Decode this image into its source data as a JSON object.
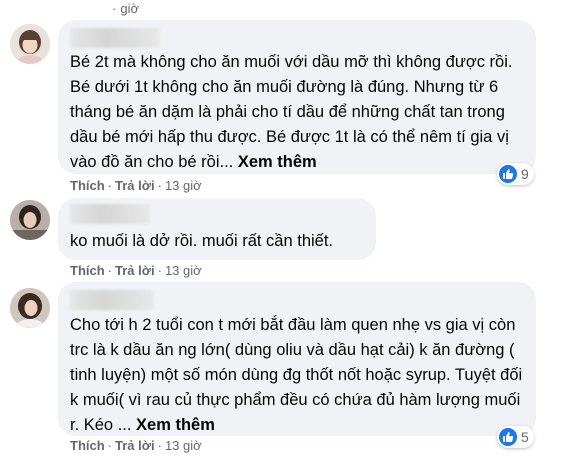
{
  "top": {
    "time": "giờ"
  },
  "comments": [
    {
      "text": "Bé 2t mà không cho ăn muối với dầu mỡ thì không được rồi. Bé dưới 1t không cho ăn muối đường là đúng. Nhưng từ 6 tháng bé ăn dặm là phải cho tí dầu để những chất tan trong dầu bé mới hấp thu được. Bé được 1t là có thể nêm tí gia vị vào đồ ăn cho bé rồi...",
      "see_more": "Xem thêm",
      "like_label": "Thích",
      "reply_label": "Trả lời",
      "time": "13 giờ",
      "reactions": "9"
    },
    {
      "text": "ko muối là dở rồi. muối rất cần thiết.",
      "like_label": "Thích",
      "reply_label": "Trả lời",
      "time": "13 giờ"
    },
    {
      "text": "Cho tới h 2 tuổi con t mới bắt đầu làm quen nhẹ vs gia vị còn trc là k dầu ăn ng lớn( dùng oliu và dầu hạt cải) k ăn đường ( tinh luyện) một số món dùng đg thốt nốt hoặc syrup. Tuyệt đối k muối( vì rau củ thực phẩm đều có chứa đủ hàm lượng muối r. Kéo ...",
      "see_more": "Xem thêm",
      "like_label": "Thích",
      "reply_label": "Trả lời",
      "time": "13 giờ",
      "reactions": "5"
    }
  ],
  "colors": {
    "bubble": "#f0f2f5",
    "meta": "#65676b",
    "like_blue": "#1877f2"
  },
  "icons": [
    "thumbs-up-icon",
    "avatar-photo"
  ]
}
